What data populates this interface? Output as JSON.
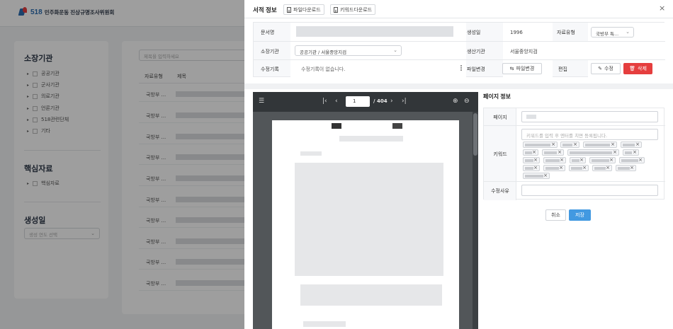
{
  "background": {
    "logo_number": "518",
    "logo_text": "민주화운동 진상규명조사위원회",
    "institution_title": "소장기관",
    "institutions": [
      "공공기관",
      "군사기관",
      "의료기관",
      "언론기관",
      "518관련단체",
      "기타"
    ],
    "core_title": "핵심자료",
    "core_items": [
      "핵심자료"
    ],
    "created_title": "생성일",
    "created_placeholder": "생성 연도 선택",
    "search_placeholder": "제목을 입력하세요",
    "col_type": "자료유형",
    "col_title": "제목",
    "row_type_label": "국방부 ..."
  },
  "modal": {
    "title": "서적 정보",
    "file_download": "파일다운로드",
    "keyword_download": "키워드다운로드",
    "close_icon": "×",
    "labels": {
      "doc_name": "문서명",
      "created_date": "생성일",
      "material_type": "자료유형",
      "holding_org": "소장기관",
      "producing_org": "생산기관",
      "edit_history": "수정기록",
      "file_change": "파일변경",
      "edit": "편집"
    },
    "values": {
      "created_date": "1996",
      "material_type": "국방부 특...",
      "holding_org": "공공기관 / 서울중앙지검",
      "producing_org": "서울중앙지검",
      "edit_history": "수정기록이 없습니다.",
      "file_change_btn": "파일변경",
      "edit_btn": "수정",
      "delete_btn": "삭제"
    }
  },
  "viewer": {
    "current_page": "1",
    "total_pages": "/ 404"
  },
  "page_info": {
    "title": "페이지 정보",
    "page_label": "페이지",
    "keyword_label": "키워드",
    "keyword_placeholder": "키워드를 입력 후 엔터를 치면 등록됩니다.",
    "reason_label": "수정사유",
    "cancel": "취소",
    "save": "저장"
  },
  "colors": {
    "accent": "#4299e1",
    "danger": "#e53e3e",
    "viewer_bg": "#525659",
    "viewer_toolbar": "#323639"
  }
}
